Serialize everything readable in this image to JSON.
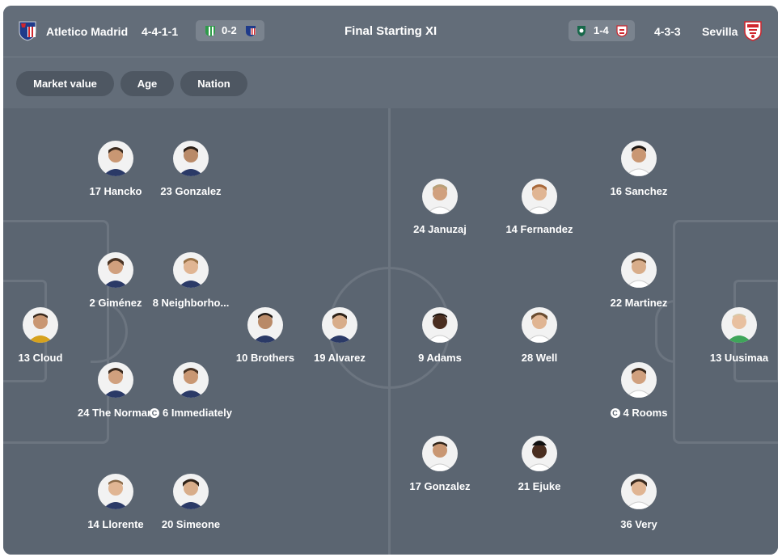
{
  "header": {
    "home_team": "Atletico Madrid",
    "home_formation": "4-4-1-1",
    "home_last_score": "0-2",
    "title": "Final Starting XI",
    "away_last_score": "1-4",
    "away_formation": "4-3-3",
    "away_team": "Sevilla"
  },
  "filters": [
    "Market value",
    "Age",
    "Nation"
  ],
  "home_players": [
    {
      "name": "17 Hancko"
    },
    {
      "name": "23 Gonzalez"
    },
    {
      "name": "2 Giménez"
    },
    {
      "name": "8 Neighborho..."
    },
    {
      "name": "13 Cloud"
    },
    {
      "name": "10 Brothers"
    },
    {
      "name": "19 Alvarez"
    },
    {
      "name": "24 The Norman"
    },
    {
      "name": "6 Immediately",
      "captain": true
    },
    {
      "name": "14 Llorente"
    },
    {
      "name": "20 Simeone"
    }
  ],
  "away_players": [
    {
      "name": "16 Sanchez"
    },
    {
      "name": "24 Januzaj"
    },
    {
      "name": "14 Fernandez"
    },
    {
      "name": "22 Martinez"
    },
    {
      "name": "9 Adams"
    },
    {
      "name": "28 Well"
    },
    {
      "name": "13 Uusimaa"
    },
    {
      "name": "4 Rooms",
      "captain": true
    },
    {
      "name": "17 Gonzalez"
    },
    {
      "name": "21 Ejuke"
    },
    {
      "name": "36 Very"
    }
  ],
  "colors": {
    "card": "#5b6571",
    "header": "#636d79",
    "pill": "#4e5762",
    "pitch_lines": "#6c7580"
  },
  "icons": [
    "atletico-crest-icon",
    "sevilla-crest-icon",
    "betis-crest-icon",
    "captain-icon"
  ]
}
